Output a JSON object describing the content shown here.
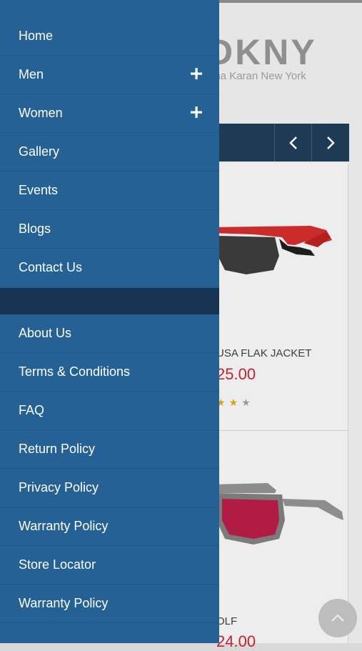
{
  "background": {
    "brand": {
      "name": "DKNY",
      "tagline": "nna Karan New York"
    },
    "products": [
      {
        "name": "USA FLAK JACKET",
        "price": "25.00",
        "rating": 3,
        "rating_max": 5
      },
      {
        "name": "OLF",
        "price": "24.00"
      }
    ],
    "colors": {
      "price": "#c8202c",
      "star": "#d4a416",
      "carousel_bar": "#1f3a54"
    }
  },
  "drawer": {
    "primary_items": [
      {
        "label": "Home",
        "expandable": false
      },
      {
        "label": "Men",
        "expandable": true
      },
      {
        "label": "Women",
        "expandable": true
      },
      {
        "label": "Gallery",
        "expandable": false
      },
      {
        "label": "Events",
        "expandable": false
      },
      {
        "label": "Blogs",
        "expandable": false
      },
      {
        "label": "Contact Us",
        "expandable": false
      }
    ],
    "secondary_items": [
      {
        "label": "About Us"
      },
      {
        "label": "Terms & Conditions"
      },
      {
        "label": "FAQ"
      },
      {
        "label": "Return Policy"
      },
      {
        "label": "Privacy Policy"
      },
      {
        "label": "Warranty Policy"
      },
      {
        "label": "Store Locator"
      },
      {
        "label": "Warranty Policy"
      }
    ],
    "colors": {
      "background": "#256195",
      "separator": "#173552",
      "text": "#ffffff"
    }
  },
  "icons": {
    "expand": "plus-icon",
    "carousel_prev": "chevron-left-icon",
    "carousel_next": "chevron-right-icon",
    "scroll_top": "chevron-up-icon"
  }
}
